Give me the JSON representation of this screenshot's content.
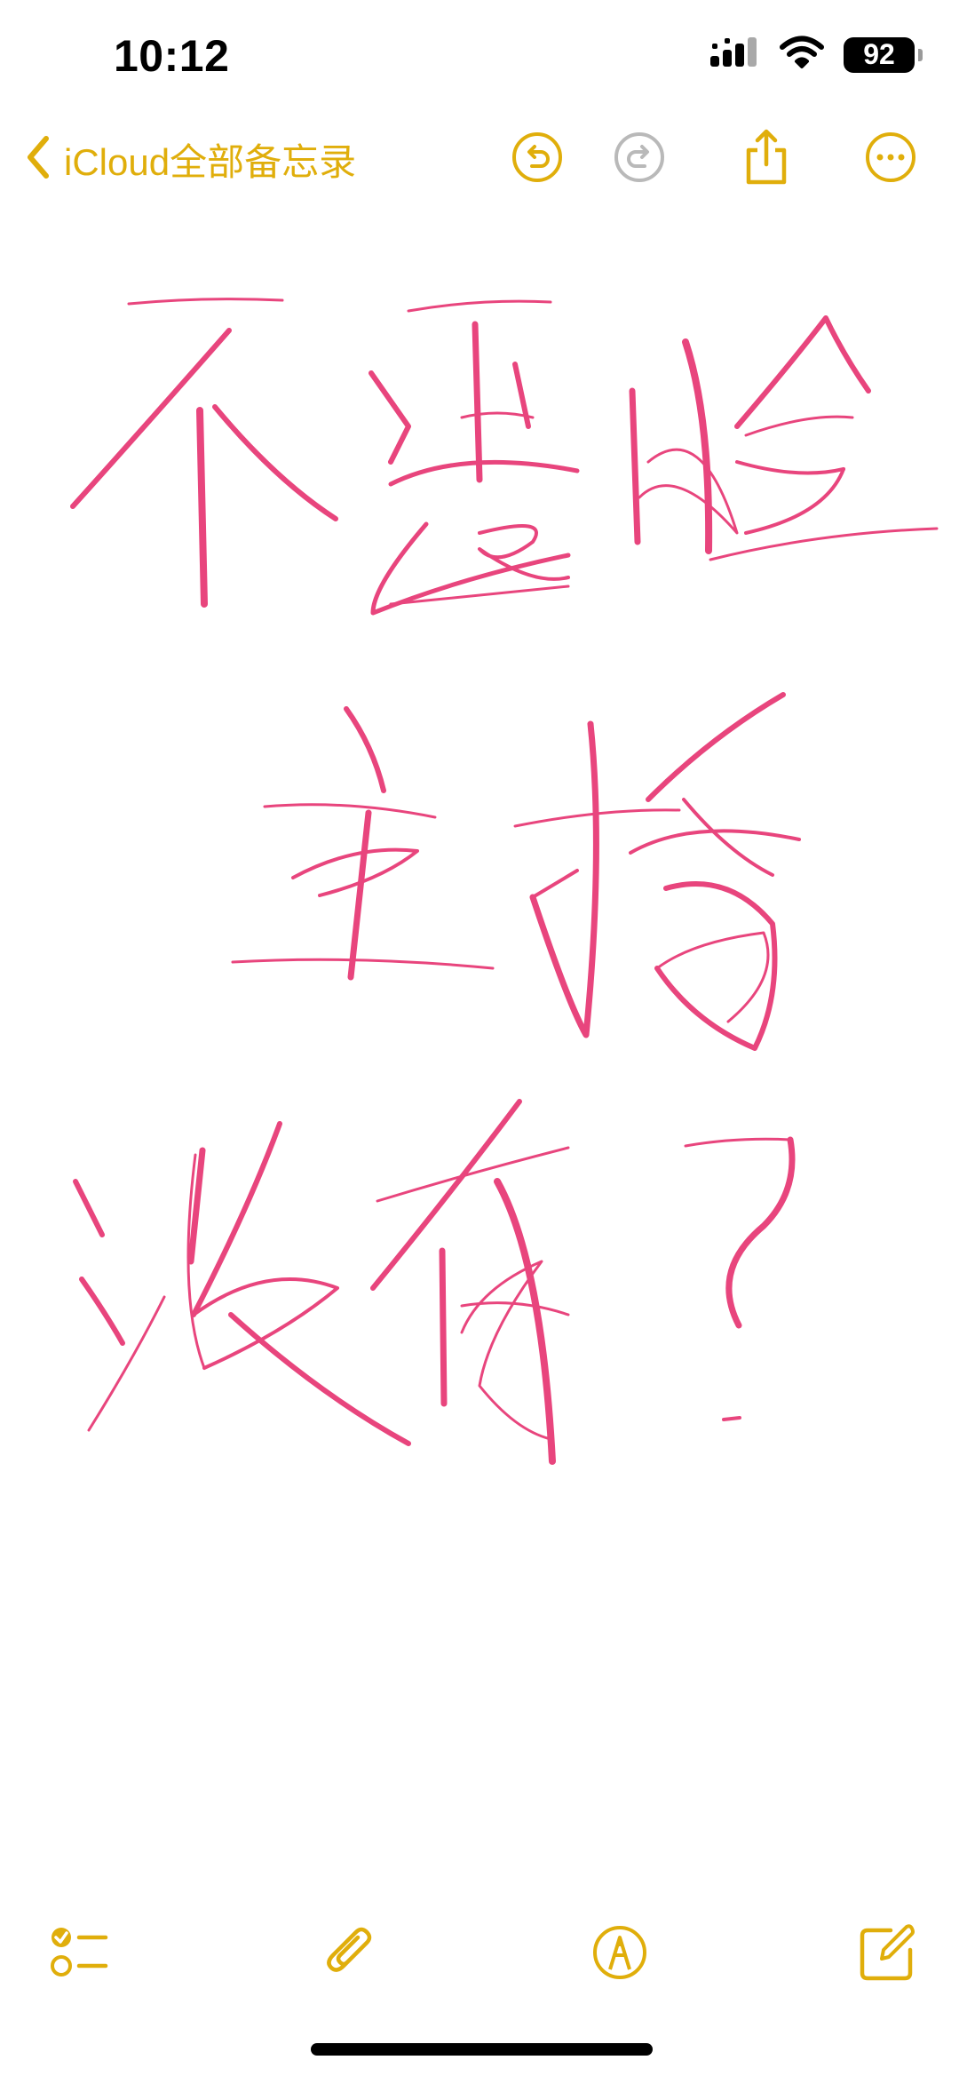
{
  "status_bar": {
    "time": "10:12",
    "battery": "92",
    "icons": [
      "cellular-signal-icon",
      "wifi-icon",
      "battery-icon"
    ]
  },
  "nav": {
    "back_label": "iCloud全部备忘录",
    "icons": [
      "chevron-left-icon",
      "undo-icon",
      "redo-icon",
      "share-icon",
      "more-icon"
    ]
  },
  "note": {
    "handwritten_lines": [
      "不露脸",
      "主播",
      "没有？"
    ],
    "ink_color": "#e8457d"
  },
  "toolbar": {
    "icons": [
      "checklist-icon",
      "attachment-icon",
      "markup-icon",
      "compose-icon"
    ]
  },
  "colors": {
    "accent": "#e0ae0b",
    "disabled": "#b9b9b9",
    "ink": "#e8457d"
  }
}
